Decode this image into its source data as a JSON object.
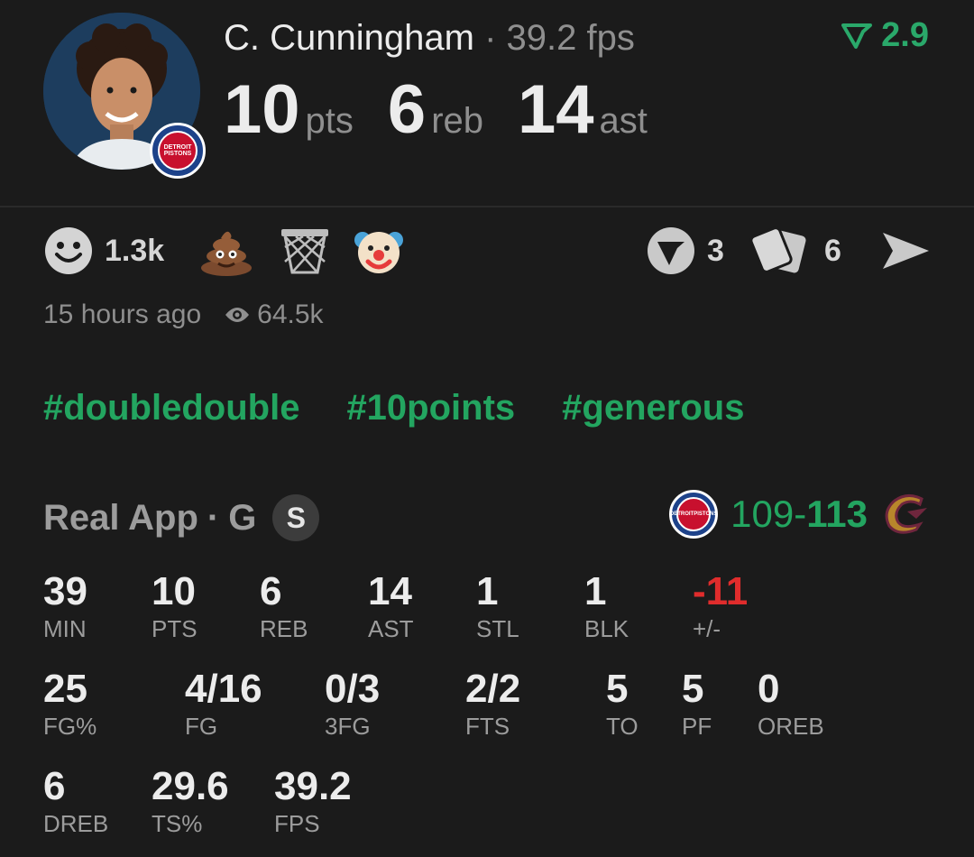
{
  "player": {
    "name": "C. Cunningham",
    "separator": "·",
    "fps_line": "39.2 fps",
    "team_abbr_lines": [
      "DETROIT",
      "PISTONS"
    ]
  },
  "delta": {
    "value": "2.9",
    "color": "#2aa86a"
  },
  "headline": [
    {
      "value": "10",
      "unit": "pts"
    },
    {
      "value": "6",
      "unit": "reb"
    },
    {
      "value": "14",
      "unit": "ast"
    }
  ],
  "reactions": {
    "smile_count": "1.3k",
    "items": [
      "smile-icon",
      "poop-emoji",
      "basketball-hoop-icon",
      "clown-emoji"
    ],
    "vote_count": "3",
    "cards_count": "6"
  },
  "meta": {
    "time_ago": "15 hours ago",
    "views": "64.5k"
  },
  "tags": [
    "#doubledouble",
    "#10points",
    "#generous"
  ],
  "game": {
    "source": "Real App",
    "separator": "·",
    "position": "G",
    "badge": "S",
    "score_left": "109-",
    "score_right": "113"
  },
  "stats": [
    {
      "value": "39",
      "label": "MIN"
    },
    {
      "value": "10",
      "label": "PTS"
    },
    {
      "value": "6",
      "label": "REB"
    },
    {
      "value": "14",
      "label": "AST"
    },
    {
      "value": "1",
      "label": "STL"
    },
    {
      "value": "1",
      "label": "BLK"
    },
    {
      "value": "-11",
      "label": "+/-"
    },
    {
      "value": "25",
      "label": "FG%"
    },
    {
      "value": "4/16",
      "label": "FG"
    },
    {
      "value": "0/3",
      "label": "3FG"
    },
    {
      "value": "2/2",
      "label": "FTS"
    },
    {
      "value": "5",
      "label": "TO"
    },
    {
      "value": "5",
      "label": "PF"
    },
    {
      "value": "0",
      "label": "OREB"
    },
    {
      "value": "6",
      "label": "DREB"
    },
    {
      "value": "29.6",
      "label": "TS%"
    },
    {
      "value": "39.2",
      "label": "FPS"
    }
  ],
  "colors": {
    "background": "#1b1b1b",
    "accent_green": "#23a560",
    "negative_red": "#e02c2c",
    "muted_text": "#8f8f8f"
  }
}
